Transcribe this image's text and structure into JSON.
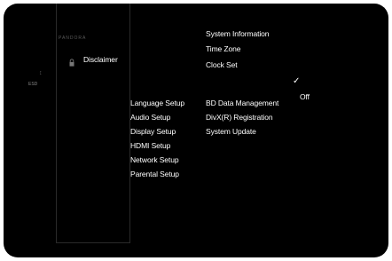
{
  "brand_text": "PANDORA",
  "left_panel": {
    "item_label": "Disclaimer",
    "lock_icon": "lock-icon",
    "side_glyph": "↕",
    "side_small": "ESD"
  },
  "setup_menu": {
    "items": [
      "Language Setup",
      "Audio Setup",
      "Display Setup",
      "HDMI Setup",
      "Network Setup",
      "Parental Setup"
    ]
  },
  "submenu": {
    "top_items": [
      "System Information",
      "Time Zone",
      "Clock Set"
    ],
    "bottom_items": [
      "BD Data Management",
      "DivX(R) Registration",
      "System Update"
    ]
  },
  "value_panel": {
    "check": "✓",
    "value": "Off"
  }
}
